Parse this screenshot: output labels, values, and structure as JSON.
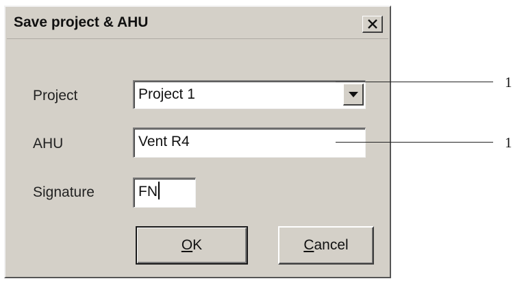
{
  "dialog": {
    "title": "Save project & AHU",
    "close_label": "×"
  },
  "form": {
    "project_label": "Project",
    "project_value": "Project 1",
    "ahu_label": "AHU",
    "ahu_value": "Vent R4",
    "signature_label": "Signature",
    "signature_value": "FN"
  },
  "buttons": {
    "ok_mnemonic": "O",
    "ok_rest": "K",
    "cancel_mnemonic": "C",
    "cancel_rest": "ancel"
  },
  "callouts": [
    {
      "number": "1"
    },
    {
      "number": "1"
    }
  ],
  "icons": {
    "close": "close-icon",
    "dropdown": "dropdown-arrow-icon"
  }
}
